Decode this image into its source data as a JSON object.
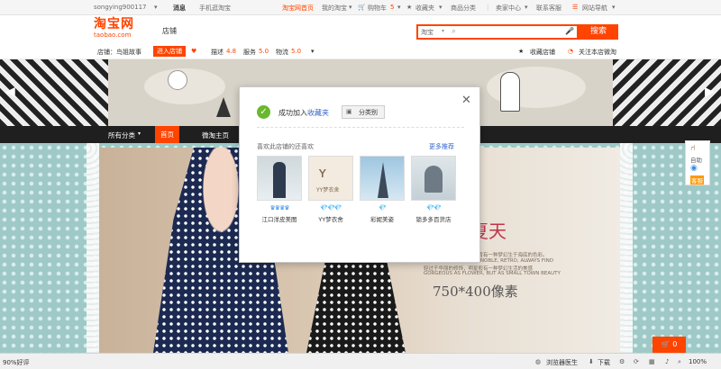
{
  "topnav": {
    "username": "songying900117",
    "messages": "消息",
    "mobile": "手机逛淘宝",
    "home": "淘宝网首页",
    "my_taobao": "我的淘宝",
    "cart": "购物车",
    "cart_count": "5",
    "favorites": "收藏夹",
    "categories": "商品分类",
    "seller_center": "卖家中心",
    "contact": "联系客服",
    "site_nav": "网站导航"
  },
  "header": {
    "logo_cn": "淘宝网",
    "logo_en": "taobao.com",
    "shop_label": "店铺",
    "search_scope": "淘宝",
    "search_placeholder": "",
    "search_button": "搜索"
  },
  "shopbar": {
    "shop_name": "店铺：鸟姐故事",
    "enter_shop": "进入店铺",
    "desc_label": "描述",
    "desc_score": "4.8",
    "service_label": "服务",
    "service_score": "5.0",
    "logistics_label": "物流",
    "logistics_score": "5.0",
    "fav_shop": "收藏店铺",
    "follow_shop": "关注本店微淘"
  },
  "shopnav": {
    "all_categories": "所有分类",
    "home": "首页",
    "weitao": "微淘主页"
  },
  "modal": {
    "message_prefix": "成功加入",
    "message_link": "收藏夹",
    "classify_label": "分类别",
    "rec_title": "喜欢此店铺的还喜欢",
    "more": "更多推荐",
    "shops": [
      {
        "name": "江口洋皮美图",
        "rating": "♛♛♛♛"
      },
      {
        "name": "YY梦衣舍",
        "rating": "💎💎💎"
      },
      {
        "name": "彩妮美姿",
        "rating": "💎"
      },
      {
        "name": "锁多多百货店",
        "rating": "💎💎"
      }
    ]
  },
  "promo": {
    "title": "夏天",
    "subtitle": "ER",
    "line1": "初过于华丽的修饰，但是肯有一种梦幻生于海底的色彩。",
    "line2": "IT IS QUIET, ELEGANT, NOBLE, RETRO, ALWAYS FIND",
    "line3": "轻过于华丽的修饰，明星般有一种梦幻生活的美感",
    "line4": "GORGEOUS AS FLOWER, BUT AS SMALL TOWN BEAUTY",
    "size_text": "750*400像素"
  },
  "side_widget": {
    "label1": "自助",
    "label2": "客服"
  },
  "cart_float": {
    "count": "0"
  },
  "statusbar": {
    "rating": "90%好评",
    "doctor": "浏览器医生",
    "download": "下载",
    "zoom": "100%"
  }
}
